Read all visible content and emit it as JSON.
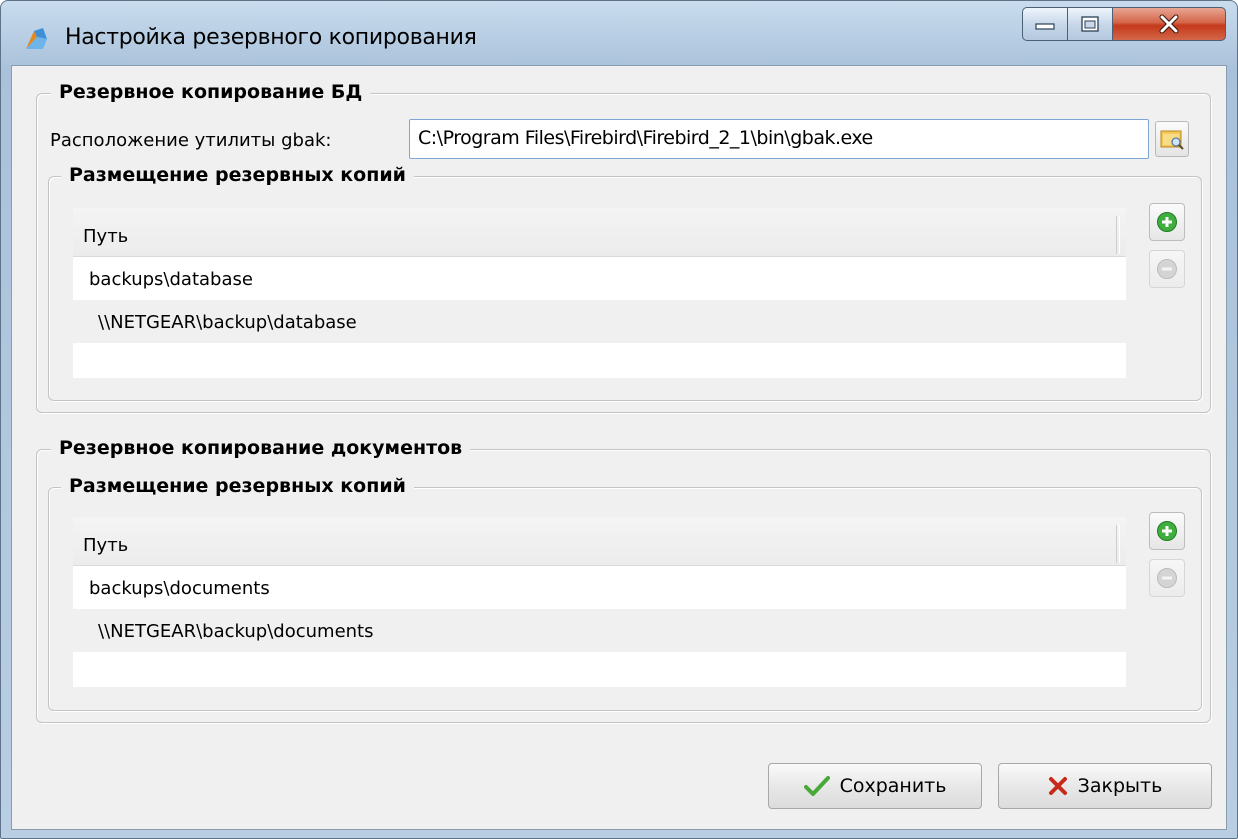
{
  "window": {
    "title": "Настройка резервного копирования",
    "icons": {
      "app": "backup-app-icon",
      "minimize": "minimize-icon",
      "maximize": "maximize-icon",
      "close": "close-icon"
    }
  },
  "db_backup": {
    "legend": "Резервное копирование БД",
    "gbak_label": "Расположение утилиты gbak:",
    "gbak_path": "C:\\Program Files\\Firebird\\Firebird_2_1\\bin\\gbak.exe",
    "locations": {
      "legend": "Размещение резервных копий",
      "column_header": "Путь",
      "rows": [
        "backups\\database",
        "\\\\NETGEAR\\backup\\database"
      ]
    }
  },
  "doc_backup": {
    "legend": "Резервное копирование документов",
    "locations": {
      "legend": "Размещение резервных копий",
      "column_header": "Путь",
      "rows": [
        "backups\\documents",
        "\\\\NETGEAR\\backup\\documents"
      ]
    }
  },
  "buttons": {
    "save": "Сохранить",
    "close": "Закрыть"
  },
  "colors": {
    "add_green": "#3fae3f",
    "save_check": "#48a838",
    "close_x": "#c62a1a",
    "close_button": "#c4391b"
  }
}
